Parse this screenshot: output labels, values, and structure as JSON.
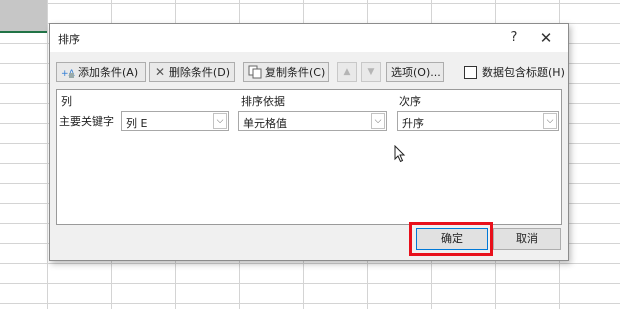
{
  "dialog": {
    "title": "排序",
    "help_label": "?",
    "close_label": "✕"
  },
  "toolbar": {
    "add_label": "添加条件(A)",
    "delete_label": "删除条件(D)",
    "copy_label": "复制条件(C)",
    "up_label": "▲",
    "down_label": "▼",
    "options_label": "选项(O)...",
    "header_checkbox_label": "数据包含标题(H)"
  },
  "table": {
    "col_header": "列",
    "sort_on_header": "排序依据",
    "order_header": "次序",
    "rows": [
      {
        "label": "主要关键字",
        "column": "列 E",
        "sort_on": "单元格值",
        "order": "升序"
      }
    ]
  },
  "buttons": {
    "ok_label": "确定",
    "cancel_label": "取消"
  },
  "colors": {
    "highlight": "#e8101b",
    "ok_border": "#0078d7",
    "selected_cell_border": "#217346"
  }
}
